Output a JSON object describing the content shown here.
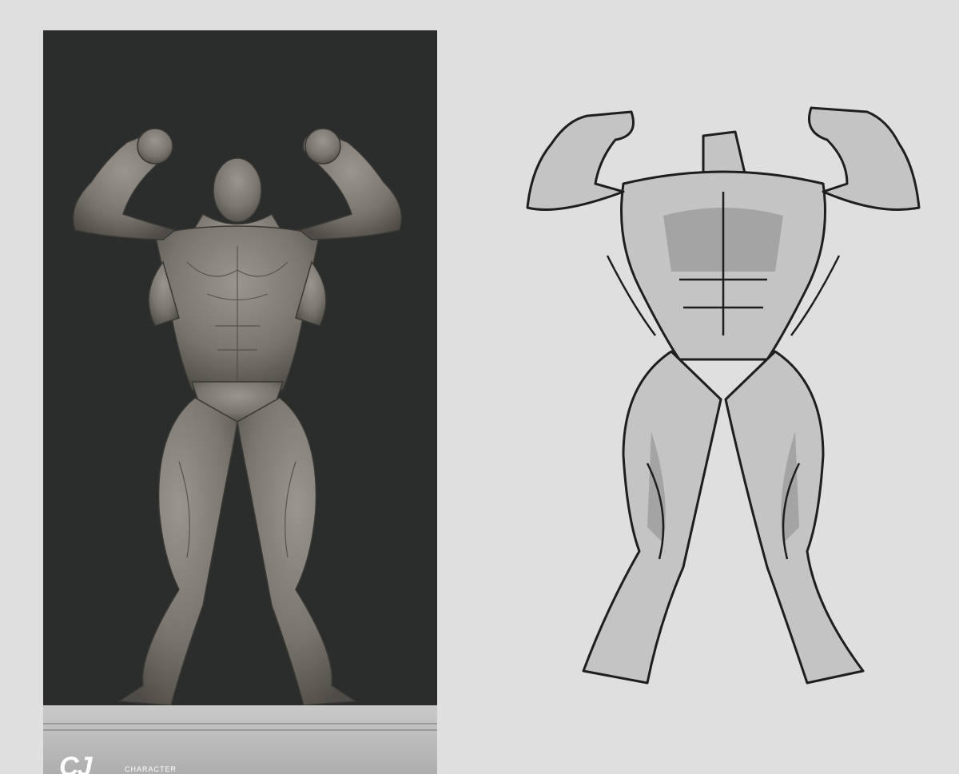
{
  "left_render": {
    "description_visible": false,
    "background": "#2a2d2b",
    "figure_color": "#7b7873",
    "pedestal_color": "#bcbcbc"
  },
  "footer": {
    "logo_text": "CJ",
    "caption": "CHARACTER"
  },
  "right_sketch": {
    "stroke_color": "#1e1e1e",
    "fill_light": "#c8c8c8",
    "fill_mid": "#9e9e9e"
  }
}
